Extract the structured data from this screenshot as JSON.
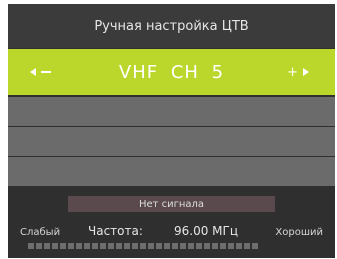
{
  "header": {
    "title": "Ручная настройка ЦТВ"
  },
  "selector": {
    "value": "VHF CH 5"
  },
  "status": {
    "message": "Нет сигнала"
  },
  "signal": {
    "weak_label": "Слабый",
    "good_label": "Хороший",
    "frequency_label": "Частота:",
    "frequency_value": "96.00 МГц",
    "segments_total": 29,
    "level": 0
  },
  "colors": {
    "accent": "#bcd72c",
    "background": "#2f2f2f",
    "row": "#6b6b6b"
  }
}
